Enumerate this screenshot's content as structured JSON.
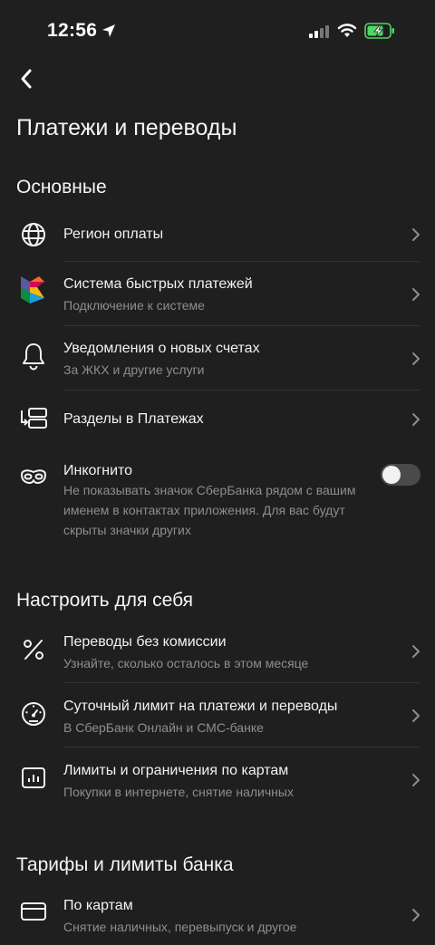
{
  "status_bar": {
    "time": "12:56"
  },
  "header": {
    "title": "Платежи и переводы"
  },
  "sections": [
    {
      "title": "Основные",
      "items": [
        {
          "title": "Регион оплаты",
          "subtitle": ""
        },
        {
          "title": "Система быстрых платежей",
          "subtitle": "Подключение к системе"
        },
        {
          "title": "Уведомления о новых счетах",
          "subtitle": "За ЖКХ и другие услуги"
        },
        {
          "title": "Разделы в Платежах",
          "subtitle": ""
        },
        {
          "title": "Инкогнито",
          "description": "Не показывать значок СберБанка рядом с вашим именем в контактах приложения. Для вас будут скрыты значки других",
          "toggle_on": false
        }
      ]
    },
    {
      "title": "Настроить для себя",
      "items": [
        {
          "title": "Переводы без комиссии",
          "subtitle": "Узнайте, сколько осталось в этом месяце"
        },
        {
          "title": "Суточный лимит на платежи и переводы",
          "subtitle": "В СберБанк Онлайн и СМС-банке"
        },
        {
          "title": "Лимиты и ограничения по картам",
          "subtitle": "Покупки в интернете, снятие наличных"
        }
      ]
    },
    {
      "title": "Тарифы и лимиты банка",
      "items": [
        {
          "title": "По картам",
          "subtitle": "Снятие наличных, перевыпуск и другое"
        }
      ]
    }
  ],
  "colors": {
    "background": "#1f1f1f",
    "text": "#f2f2f2",
    "secondary_text": "#8e8e8e",
    "battery_green": "#4cd964"
  },
  "icons": [
    "location-arrow-icon",
    "signal-icon",
    "wifi-icon",
    "battery-charging-icon",
    "back-chevron-icon",
    "globe-icon",
    "sbp-logo-icon",
    "bell-icon",
    "sections-icon",
    "incognito-mask-icon",
    "percent-icon",
    "speedometer-icon",
    "chart-icon",
    "card-icon",
    "chevron-right-icon"
  ]
}
